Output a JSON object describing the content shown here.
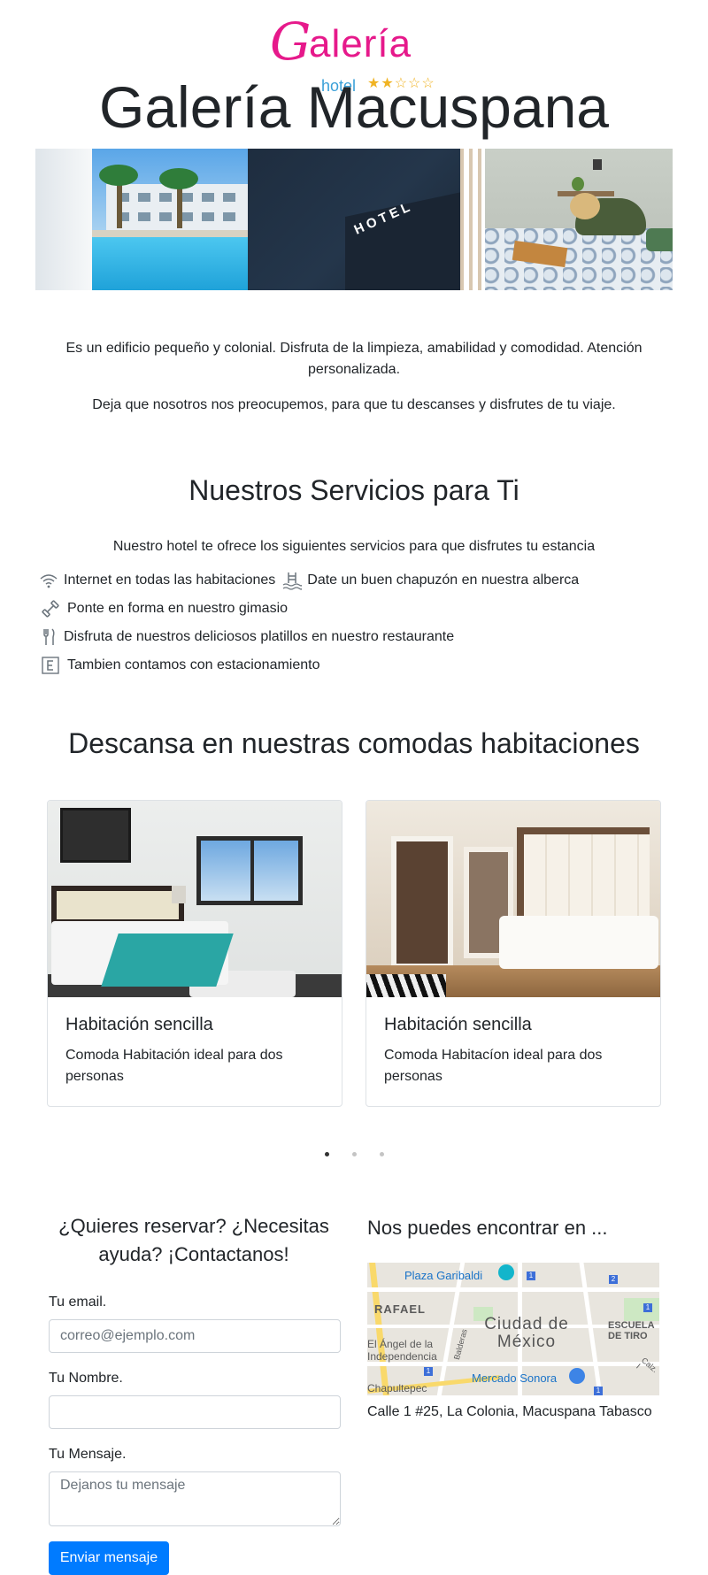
{
  "logo": {
    "initial": "G",
    "word": "alería",
    "sub": "hotel",
    "stars": "★★☆☆☆"
  },
  "header": {
    "title": "Galería Macuspana"
  },
  "intro": {
    "p1": "Es un edificio pequeño y colonial. Disfruta de la limpieza, amabilidad y comodidad. Atención personalizada.",
    "p2": "Deja que nosotros nos preocupemos, para que tu descanses y disfrutes de tu viaje."
  },
  "services": {
    "title": "Nuestros Servicios para Ti",
    "subtitle": "Nuestro hotel te ofrece los siguientes servicios para que disfrutes tu estancia",
    "internet": "Internet en todas las habitaciones",
    "pool": "Date un buen chapuzón en nuestra alberca",
    "gym": "Ponte en forma en nuestro gimasio",
    "restaurant": "Disfruta de nuestros deliciosos platillos en nuestro restaurante",
    "parking": "Tambien contamos con estacionamiento"
  },
  "rooms": {
    "title": "Descansa en nuestras comodas habitaciones",
    "cards": [
      {
        "title": "Habitación sencilla",
        "text": "Comoda Habitación ideal para dos personas"
      },
      {
        "title": "Habitación sencilla",
        "text": "Comoda Habitacíon ideal para dos personas"
      }
    ]
  },
  "banner": {
    "hotel_sign": "HOTEL"
  },
  "contact": {
    "title": "¿Quieres reservar? ¿Necesitas ayuda? ¡Contactanos!",
    "email_label": "Tu email.",
    "email_placeholder": "correo@ejemplo.com",
    "name_label": "Tu Nombre.",
    "message_label": "Tu Mensaje.",
    "message_placeholder": "Dejanos tu mensaje",
    "submit": "Enviar mensaje"
  },
  "location": {
    "title": "Nos puedes encontrar en ...",
    "address": "Calle 1 #25, La Colonia, Macuspana Tabasco",
    "map_labels": {
      "garibaldi": "Plaza Garibaldi",
      "rafael": "RAFAEL",
      "city_line1": "Ciudad de",
      "city_line2": "México",
      "angel_line1": "El Ángel de la",
      "angel_line2": "Independencia",
      "sonora": "Mercado Sonora",
      "escuela_line1": "ESCUELA",
      "escuela_line2": "DE TIRO",
      "chapultepec": "Chapultepec",
      "balderas": "Balderas",
      "calz": "Calz. I"
    }
  },
  "carousel": {
    "pages": 3,
    "active": 0
  },
  "colors": {
    "brand_pink": "#e6198b",
    "brand_blue": "#3aa0d8",
    "star": "#f0b323",
    "primary_button": "#007bff"
  }
}
